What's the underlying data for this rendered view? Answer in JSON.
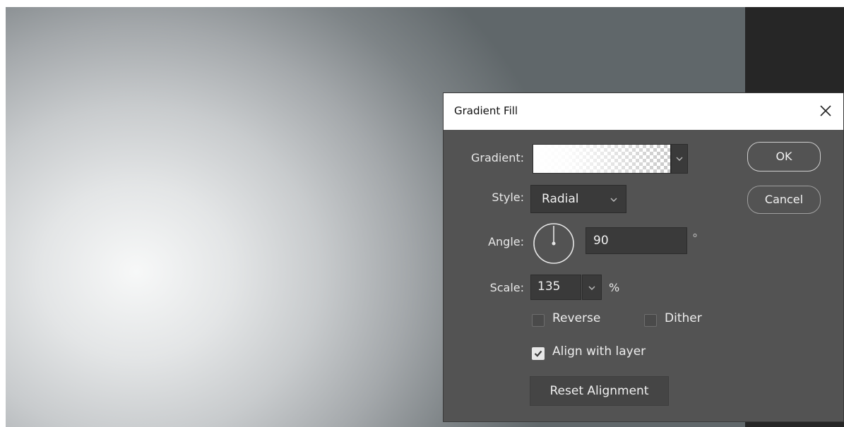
{
  "dialog": {
    "title": "Gradient Fill",
    "gradient_label": "Gradient:",
    "style_label": "Style:",
    "style_value": "Radial",
    "angle_label": "Angle:",
    "angle_value": "90",
    "degree_symbol": "°",
    "scale_label": "Scale:",
    "scale_value": "135",
    "percent_symbol": "%",
    "reverse_label": "Reverse",
    "reverse_checked": false,
    "dither_label": "Dither",
    "dither_checked": false,
    "align_label": "Align with layer",
    "align_checked": true,
    "reset_label": "Reset Alignment",
    "ok_label": "OK",
    "cancel_label": "Cancel"
  },
  "colors": {
    "dialog_bg": "#535353",
    "field_bg": "#3a3a3a",
    "app_dark": "#262626"
  },
  "icons": [
    "close-icon",
    "chevron-down-icon",
    "checkmark-icon",
    "angle-dial-icon"
  ]
}
